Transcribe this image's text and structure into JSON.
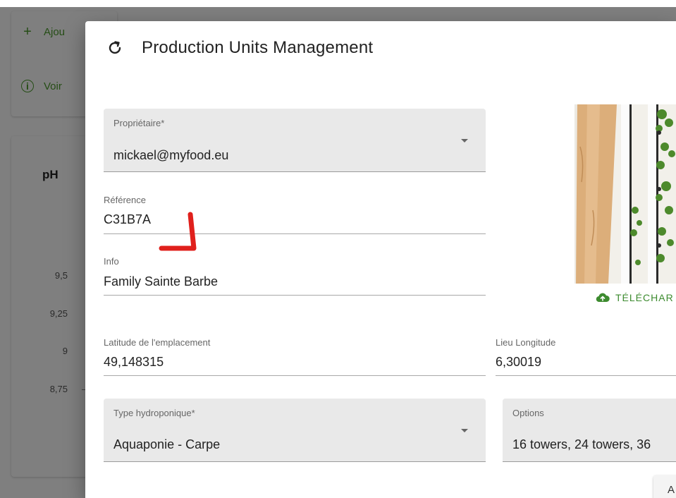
{
  "background": {
    "actions": [
      {
        "icon": "plus-icon",
        "label": "Ajou"
      },
      {
        "icon": "info-icon",
        "label": "Voir"
      }
    ],
    "chart_title": "pH",
    "chart_ticks": [
      "9,5",
      "9,25",
      "9",
      "8,75"
    ]
  },
  "dialog": {
    "title": "Production Units Management",
    "fields": {
      "owner": {
        "label": "Propriétaire*",
        "value": "mickael@myfood.eu"
      },
      "reference": {
        "label": "Référence",
        "value": "C31B7A"
      },
      "info": {
        "label": "Info",
        "value": "Family Sainte Barbe"
      },
      "latitude": {
        "label": "Latitude de l'emplacement",
        "value": "49,148315"
      },
      "longitude": {
        "label": "Lieu Longitude",
        "value": "6,30019"
      },
      "hydro_type": {
        "label": "Type hydroponique*",
        "value": "Aquaponie - Carpe"
      },
      "options": {
        "label": "Options",
        "value": "16 towers, 24 towers, 36"
      }
    },
    "upload_label": "TÉLÉCHAR",
    "bottom_button_label": "A"
  },
  "colors": {
    "accent_green": "#3d8b2f",
    "annotation_red": "#e0201c",
    "field_fill": "#e9e9e9"
  }
}
